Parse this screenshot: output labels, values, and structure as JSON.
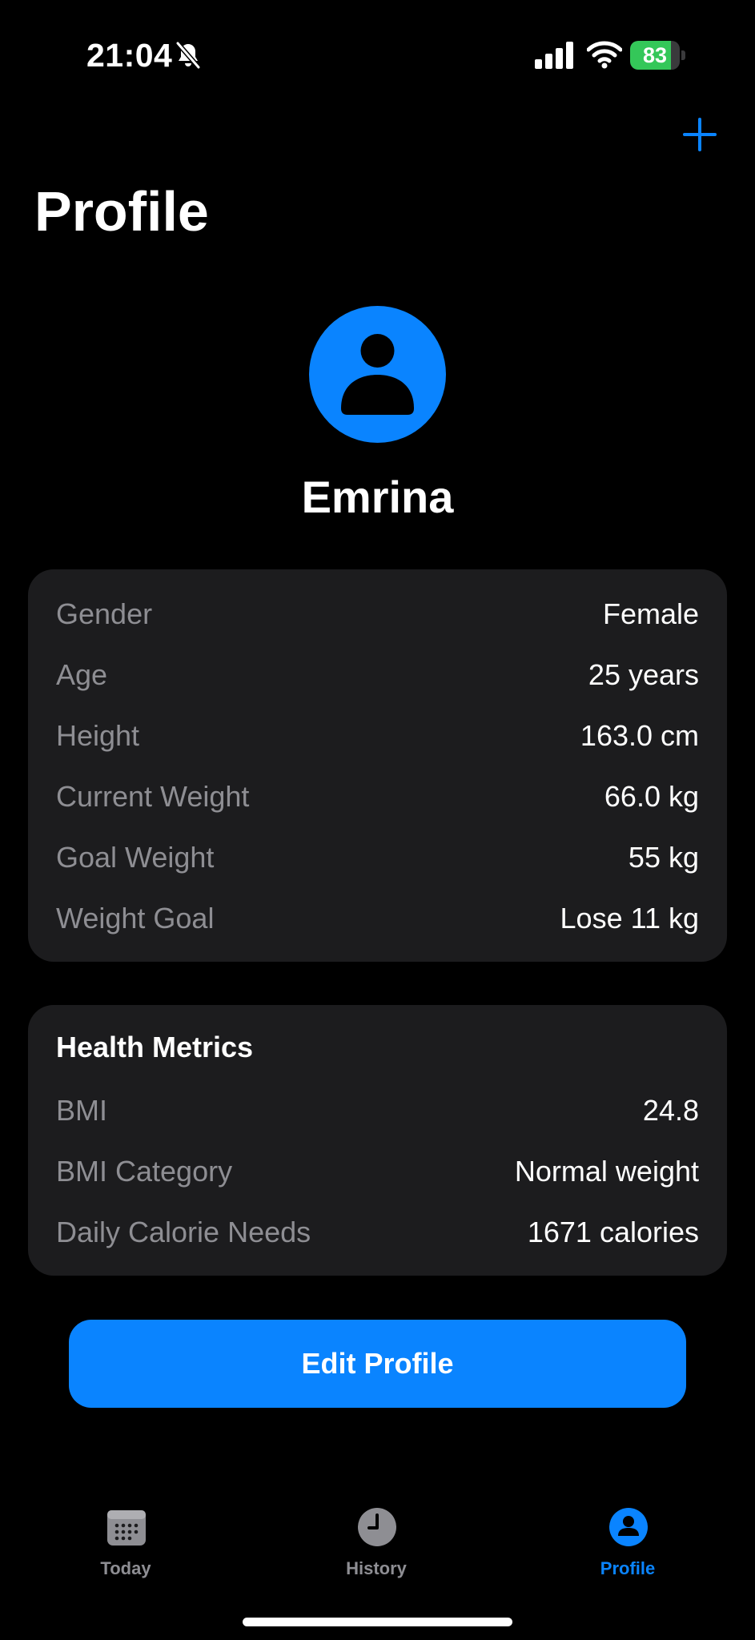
{
  "status_bar": {
    "time": "21:04",
    "battery_level": "83",
    "battery_fraction": 0.83,
    "icons": [
      "bell-slash-icon",
      "cellular-signal-icon",
      "wifi-icon",
      "battery-charging-icon"
    ]
  },
  "nav": {
    "add_icon": "plus-icon"
  },
  "page": {
    "title": "Profile"
  },
  "profile": {
    "avatar_icon": "person-icon",
    "name": "Emrina"
  },
  "info": {
    "rows": [
      {
        "label": "Gender",
        "value": "Female"
      },
      {
        "label": "Age",
        "value": "25 years"
      },
      {
        "label": "Height",
        "value": "163.0 cm"
      },
      {
        "label": "Current Weight",
        "value": "66.0 kg"
      },
      {
        "label": "Goal Weight",
        "value": "55 kg"
      },
      {
        "label": "Weight Goal",
        "value": "Lose 11 kg"
      }
    ]
  },
  "health": {
    "title": "Health Metrics",
    "rows": [
      {
        "label": "BMI",
        "value": "24.8"
      },
      {
        "label": "BMI Category",
        "value": "Normal weight"
      },
      {
        "label": "Daily Calorie Needs",
        "value": "1671 calories"
      }
    ]
  },
  "edit_button": {
    "label": "Edit Profile"
  },
  "tabs": [
    {
      "label": "Today",
      "icon": "calendar-icon",
      "active": false
    },
    {
      "label": "History",
      "icon": "clock-icon",
      "active": false
    },
    {
      "label": "Profile",
      "icon": "person-circle-icon",
      "active": true
    }
  ],
  "colors": {
    "background": "#000000",
    "card": "#1c1c1e",
    "accent": "#0a84ff",
    "secondary_text": "#8e8e93",
    "battery_green": "#34c759"
  }
}
